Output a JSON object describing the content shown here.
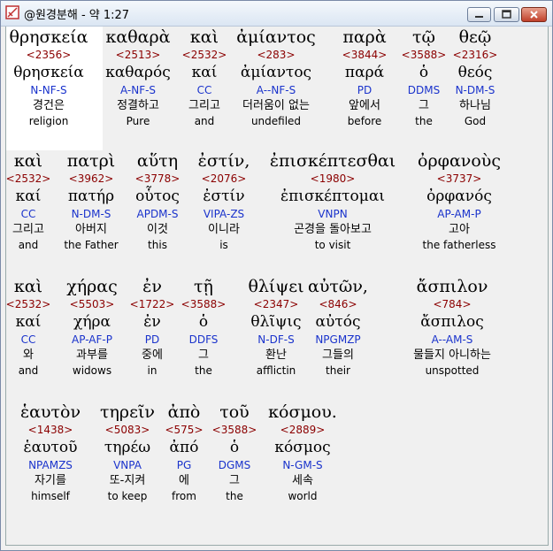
{
  "window": {
    "title": "@원경분해 - 약 1:27"
  },
  "rows": [
    [
      {
        "greek": "θρησκεία",
        "strong": "<2356>",
        "lemma": "θρησκεία",
        "parse": "N-NF-S",
        "korean": "경건은",
        "english": "religion"
      },
      {
        "greek": "καθαρὰ",
        "strong": "<2513>",
        "lemma": "καθαρός",
        "parse": "A-NF-S",
        "korean": "정결하고",
        "english": "Pure"
      },
      {
        "greek": "καὶ",
        "strong": "<2532>",
        "lemma": "καί",
        "parse": "CC",
        "korean": "그리고",
        "english": "and"
      },
      {
        "greek": "ἀμίαντος",
        "strong": "<283>",
        "lemma": "ἀμίαντος",
        "parse": "A--NF-S",
        "korean": "더러움이 없는",
        "english": "undefiled"
      },
      {
        "greek": "παρὰ",
        "strong": "<3844>",
        "lemma": "παρά",
        "parse": "PD",
        "korean": "앞에서",
        "english": "before"
      },
      {
        "greek": "τῷ",
        "strong": "<3588>",
        "lemma": "ὁ",
        "parse": "DDMS",
        "korean": "그",
        "english": "the"
      },
      {
        "greek": "θεῷ",
        "strong": "<2316>",
        "lemma": "θεός",
        "parse": "N-DM-S",
        "korean": "하나님",
        "english": "God"
      }
    ],
    [
      {
        "greek": "καὶ",
        "strong": "<2532>",
        "lemma": "καί",
        "parse": "CC",
        "korean": "그리고",
        "english": "and"
      },
      {
        "greek": "πατρὶ",
        "strong": "<3962>",
        "lemma": "πατήρ",
        "parse": "N-DM-S",
        "korean": "아버지",
        "english": "the Father"
      },
      {
        "greek": "αὕτη",
        "strong": "<3778>",
        "lemma": "οὗτος",
        "parse": "APDM-S",
        "korean": "이것",
        "english": "this"
      },
      {
        "greek": "ἐστίν,",
        "strong": "<2076>",
        "lemma": "ἐστίν",
        "parse": "VIPA-ZS",
        "korean": "이니라",
        "english": "is"
      },
      {
        "greek": "ἐπισκέπτεσθαι",
        "strong": "<1980>",
        "lemma": "ἐπισκέπτομαι",
        "parse": "VNPN",
        "korean": "곤경을 돌아보고",
        "english": "to visit"
      },
      {
        "greek": "ὀρφανοὺς",
        "strong": "<3737>",
        "lemma": "ὀρφανός",
        "parse": "AP-AM-P",
        "korean": "고아",
        "english": "the fatherless"
      }
    ],
    [
      {
        "greek": "καὶ",
        "strong": "<2532>",
        "lemma": "καί",
        "parse": "CC",
        "korean": "와",
        "english": "and"
      },
      {
        "greek": "χήρας",
        "strong": "<5503>",
        "lemma": "χήρα",
        "parse": "AP-AF-P",
        "korean": "과부를",
        "english": "widows"
      },
      {
        "greek": "ἐν",
        "strong": "<1722>",
        "lemma": "ἐν",
        "parse": "PD",
        "korean": "중에",
        "english": "in"
      },
      {
        "greek": "τῇ",
        "strong": "<3588>",
        "lemma": "ὁ",
        "parse": "DDFS",
        "korean": "그",
        "english": "the"
      },
      {
        "greek": "θλίψει",
        "strong": "<2347>",
        "lemma": "θλῖψις",
        "parse": "N-DF-S",
        "korean": "환난",
        "english": "afflictin"
      },
      {
        "greek": "αὐτῶν,",
        "strong": "<846>",
        "lemma": "αὐτός",
        "parse": "NPGMZP",
        "korean": "그들의",
        "english": "their"
      },
      {
        "greek": "ἄσπιλον",
        "strong": "<784>",
        "lemma": "ἄσπιλος",
        "parse": "A--AM-S",
        "korean": "물들지 아니하는",
        "english": "unspotted"
      }
    ],
    [
      {
        "greek": "ἑαυτὸν",
        "strong": "<1438>",
        "lemma": "ἑαυτοῦ",
        "parse": "NPAMZS",
        "korean": "자기를",
        "english": "himself"
      },
      {
        "greek": "τηρεῖν",
        "strong": "<5083>",
        "lemma": "τηρέω",
        "parse": "VNPA",
        "korean": "또-지켜",
        "english": "to keep"
      },
      {
        "greek": "ἀπὸ",
        "strong": "<575>",
        "lemma": "ἀπό",
        "parse": "PG",
        "korean": "에",
        "english": "from"
      },
      {
        "greek": "τοῦ",
        "strong": "<3588>",
        "lemma": "ὁ",
        "parse": "DGMS",
        "korean": "그",
        "english": "the"
      },
      {
        "greek": "κόσμου.",
        "strong": "<2889>",
        "lemma": "κόσμος",
        "parse": "N-GM-S",
        "korean": "세속",
        "english": "world"
      }
    ]
  ],
  "colors": {
    "strong": "#8b0000",
    "parse": "#1a33cc",
    "highlight": "#ffffff"
  },
  "icons": [
    "app-icon",
    "minimize-icon",
    "maximize-icon",
    "close-icon"
  ]
}
